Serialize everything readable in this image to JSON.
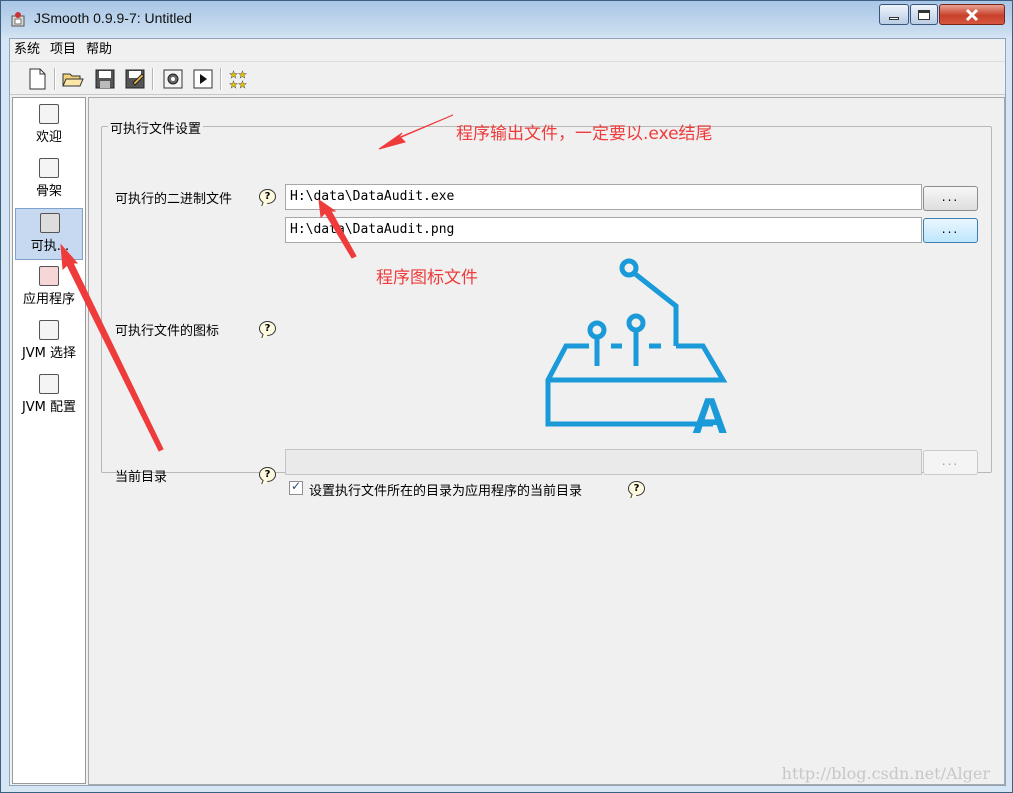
{
  "window": {
    "title": "JSmooth 0.9.9-7: Untitled"
  },
  "menu": [
    "系统",
    "项目",
    "帮助"
  ],
  "toolbar": {
    "buttons": [
      "new-icon",
      "open-folder-icon",
      "save-icon",
      "save-as-icon",
      "compile-gear-icon",
      "run-icon",
      "stars-icon"
    ]
  },
  "sidebar": {
    "items": [
      {
        "label": "欢迎"
      },
      {
        "label": "骨架"
      },
      {
        "label": "可执. ."
      },
      {
        "label": "应用程序"
      },
      {
        "label": "JVM 选择"
      },
      {
        "label": "JVM 配置"
      }
    ],
    "selected_index": 2
  },
  "executable": {
    "group_title": "可执行文件设置",
    "binary_label": "可执行的二进制文件",
    "binary_value": "H:\\data\\DataAudit.exe",
    "icon_label": "可执行文件的图标",
    "icon_value": "H:\\data\\DataAudit.png",
    "curdir_label": "当前目录",
    "curdir_value": "",
    "browse_label": "...",
    "help_glyph": "?",
    "checkbox_label": "设置执行文件所在的目录为应用程序的当前目录",
    "checkbox_checked": true,
    "preview_letter": "A",
    "preview_color": "#1a9ad9"
  },
  "annotations": {
    "exe_note": "程序输出文件，一定要以.exe结尾",
    "icon_note": "程序图标文件",
    "color": "#ee3b3b"
  },
  "watermark": "http://blog.csdn.net/Alger"
}
